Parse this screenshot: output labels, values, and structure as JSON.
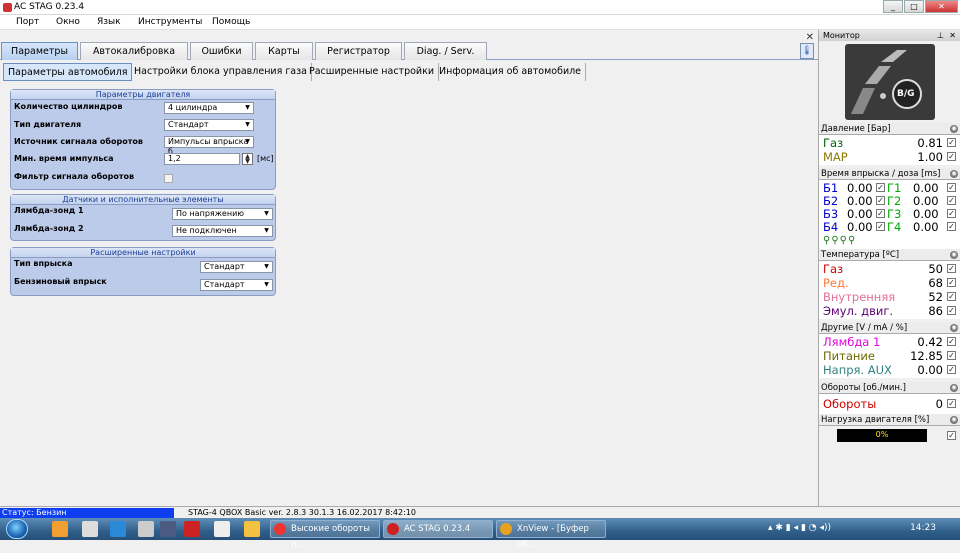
{
  "window": {
    "title": "AC STAG 0.23.4",
    "btn_min": "_",
    "btn_max": "□",
    "btn_close": "✕"
  },
  "menu": [
    "Порт",
    "Окно",
    "Язык",
    "Инструменты",
    "Помощь"
  ],
  "tabs": [
    "Параметры",
    "Автокалибровка",
    "Ошибки",
    "Карты",
    "Регистратор",
    "Diag. / Serv."
  ],
  "subtabs": [
    "Параметры автомобиля",
    "Настройки блока управления газа",
    "Расширенные настройки",
    "Информация об автомобиле"
  ],
  "engine": {
    "title": "Параметры двигателя",
    "cylinders_label": "Количество цилиндров",
    "cylinders_value": "4 цилиндра",
    "engine_type_label": "Тип двигателя",
    "engine_type_value": "Стандарт",
    "rpm_source_label": "Источник сигнала оборотов",
    "rpm_source_value": "Импульсы впрыска б",
    "min_pulse_label": "Мин. время импульса",
    "min_pulse_value": "1,2",
    "min_pulse_unit": "[мс]",
    "rpm_filter_label": "Фильтр сигнала оборотов"
  },
  "sensors": {
    "title": "Датчики и исполнительные элементы",
    "lambda1_label": "Лямбда-зонд 1",
    "lambda1_value": "По напряжению",
    "lambda2_label": "Лямбда-зонд 2",
    "lambda2_value": "Не подключен"
  },
  "advanced": {
    "title": "Расширенные настройки",
    "injection_label": "Тип впрыска",
    "injection_value": "Стандарт",
    "petrol_label": "Бензиновый впрыск",
    "petrol_value": "Стандарт"
  },
  "monitor": {
    "title": "Монитор",
    "logo_text": "B/G",
    "pressure": {
      "header": "Давление [Бар]",
      "gas_label": "Газ",
      "gas_value": "0.81",
      "map_label": "MAP",
      "map_value": "1.00"
    },
    "injection": {
      "header": "Время впрыска / доза [ms]",
      "rows": [
        {
          "b": "Б1",
          "bv": "0.00",
          "g": "Г1",
          "gv": "0.00"
        },
        {
          "b": "Б2",
          "bv": "0.00",
          "g": "Г2",
          "gv": "0.00"
        },
        {
          "b": "Б3",
          "bv": "0.00",
          "g": "Г3",
          "gv": "0.00"
        },
        {
          "b": "Б4",
          "bv": "0.00",
          "g": "Г4",
          "gv": "0.00"
        }
      ]
    },
    "temperature": {
      "header": "Температура [ºC]",
      "gas_label": "Газ",
      "gas_value": "50",
      "red_label": "Ред.",
      "red_value": "68",
      "inner_label": "Внутренняя",
      "inner_value": "52",
      "emul_label": "Эмул. двиг.",
      "emul_value": "86"
    },
    "other": {
      "header": "Другие [V / mA / %]",
      "lambda_label": "Лямбда 1",
      "lambda_value": "0.42",
      "power_label": "Питание",
      "power_value": "12.85",
      "aux_label": "Напря. AUX",
      "aux_value": "0.00"
    },
    "rpm": {
      "header": "Обороты [об./мин.]",
      "label": "Обороты",
      "value": "0"
    },
    "load": {
      "header": "Нагрузка двигателя [%]",
      "value": "0%",
      "fraction": 0
    }
  },
  "status": {
    "left": "Статус: Бензин",
    "info": "STAG-4 QBOX Basic  ver. 2.8.3  30.1.3  16.02.2017 8:42:10"
  },
  "taskbar": {
    "tasks": [
      "Высокие обороты п...",
      "AC STAG 0.23.4",
      "XnView - [Буфер об..."
    ],
    "clock": "14:23"
  },
  "colors": {
    "gas": "#006400",
    "map": "#8a7a00",
    "petrol": "#0000cc",
    "red": "#cc0000",
    "orange": "#ff7a30",
    "pink": "#e07090",
    "purple": "#5a0070",
    "magenta": "#e000e0",
    "olive": "#6a6a00",
    "teal": "#2f7f7f"
  }
}
